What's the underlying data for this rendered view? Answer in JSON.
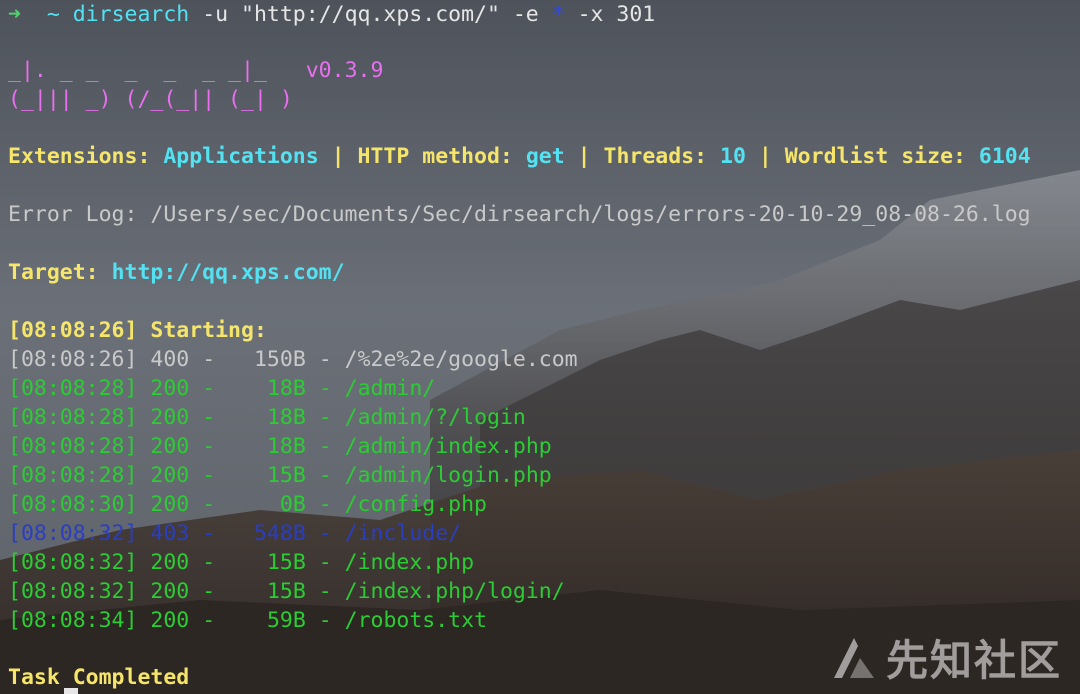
{
  "prompt": {
    "arrow": "➜",
    "tilde": "~",
    "command": "dirsearch",
    "args_before": " -u \"http://qq.xps.com/\" -e ",
    "star": "*",
    "args_after": " -x 301"
  },
  "banner": {
    "line1": "_|. _ _  _  _  _ _|_",
    "version": "v0.3.9",
    "line2": "(_||| _) (/_(_|| (_| )"
  },
  "config": {
    "ext_label": "Extensions: ",
    "ext_value": "Applications",
    "sep1": " | ",
    "method_label": "HTTP method: ",
    "method_value": "get",
    "sep2": " | ",
    "threads_label": "Threads: ",
    "threads_value": "10",
    "sep3": " | ",
    "wordlist_label": "Wordlist size: ",
    "wordlist_value": "6104"
  },
  "error_log": "Error Log: /Users/sec/Documents/Sec/dirsearch/logs/errors-20-10-29_08-08-26.log",
  "target": {
    "label": "Target: ",
    "url": "http://qq.xps.com/"
  },
  "starting": {
    "time": "[08:08:26]",
    "text": " Starting:"
  },
  "results": [
    {
      "time": "[08:08:26]",
      "status": "400",
      "size": "150B",
      "path": "/%2e%2e/google.com",
      "color": "gray"
    },
    {
      "time": "[08:08:28]",
      "status": "200",
      "size": "18B",
      "path": "/admin/",
      "color": "green"
    },
    {
      "time": "[08:08:28]",
      "status": "200",
      "size": "18B",
      "path": "/admin/?/login",
      "color": "green"
    },
    {
      "time": "[08:08:28]",
      "status": "200",
      "size": "18B",
      "path": "/admin/index.php",
      "color": "green"
    },
    {
      "time": "[08:08:28]",
      "status": "200",
      "size": "15B",
      "path": "/admin/login.php",
      "color": "green"
    },
    {
      "time": "[08:08:30]",
      "status": "200",
      "size": "0B",
      "path": "/config.php",
      "color": "green"
    },
    {
      "time": "[08:08:32]",
      "status": "403",
      "size": "548B",
      "path": "/include/",
      "color": "darkblue"
    },
    {
      "time": "[08:08:32]",
      "status": "200",
      "size": "15B",
      "path": "/index.php",
      "color": "green"
    },
    {
      "time": "[08:08:32]",
      "status": "200",
      "size": "15B",
      "path": "/index.php/login/",
      "color": "green"
    },
    {
      "time": "[08:08:34]",
      "status": "200",
      "size": "59B",
      "path": "/robots.txt",
      "color": "green"
    }
  ],
  "task": "Task Completed",
  "watermark": "先知社区",
  "colors": {
    "green": "#2ccc34",
    "gray": "#c9c9c9",
    "darkblue": "#2a3ec0",
    "yellow": "#f5e56a",
    "cyan": "#53e2f2",
    "magenta": "#ea6ef0"
  }
}
